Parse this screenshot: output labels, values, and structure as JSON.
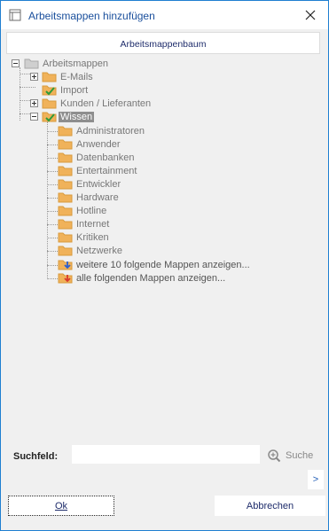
{
  "window": {
    "title": "Arbeitsmappen hinzufügen"
  },
  "tabs": [
    {
      "label": "Arbeitsmappenbaum"
    }
  ],
  "tree": {
    "root": {
      "label": "Arbeitsmappen"
    },
    "level1": [
      {
        "label": "E-Mails",
        "expander": "+"
      },
      {
        "label": "Import",
        "expander": ""
      },
      {
        "label": "Kunden / Lieferanten",
        "expander": "+"
      },
      {
        "label": "Wissen",
        "expander": "−",
        "selected": true
      }
    ],
    "wissen_children": [
      {
        "label": "Administratoren"
      },
      {
        "label": "Anwender"
      },
      {
        "label": "Datenbanken"
      },
      {
        "label": "Entertainment"
      },
      {
        "label": "Entwickler"
      },
      {
        "label": "Hardware"
      },
      {
        "label": "Hotline"
      },
      {
        "label": "Internet"
      },
      {
        "label": "Kritiken"
      },
      {
        "label": "Netzwerke"
      }
    ],
    "more_next": {
      "label": "weitere 10 folgende Mappen anzeigen..."
    },
    "more_all": {
      "label": "alle folgenden Mappen anzeigen..."
    }
  },
  "search": {
    "label": "Suchfeld:",
    "value": "",
    "button_label": "Suche"
  },
  "more_button": {
    "label": ">"
  },
  "buttons": {
    "ok": "Ok",
    "cancel": "Abbrechen"
  },
  "colors": {
    "folder": "#f0b25a",
    "check": "#2e9b3a",
    "arrow_down_blue": "#2a5fd0",
    "arrow_down_red": "#d83a2e",
    "title_text": "#1a4f9c"
  }
}
